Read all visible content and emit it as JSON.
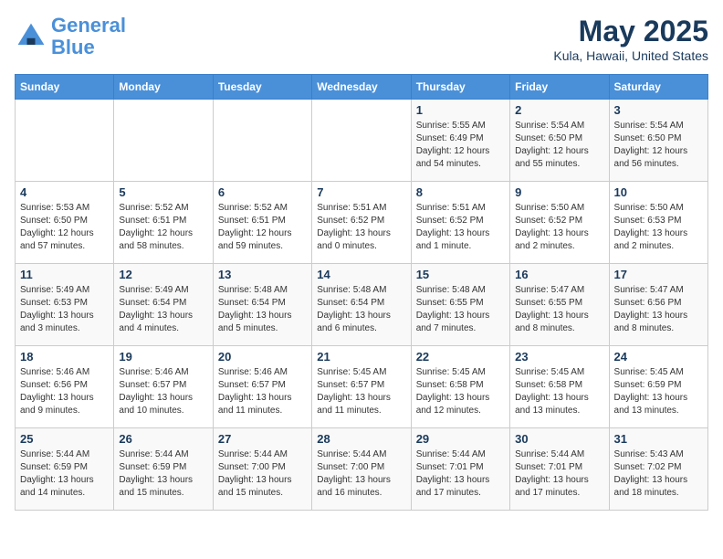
{
  "header": {
    "logo_line1": "General",
    "logo_line2": "Blue",
    "title": "May 2025",
    "subtitle": "Kula, Hawaii, United States"
  },
  "weekdays": [
    "Sunday",
    "Monday",
    "Tuesday",
    "Wednesday",
    "Thursday",
    "Friday",
    "Saturday"
  ],
  "weeks": [
    [
      {
        "day": "",
        "info": ""
      },
      {
        "day": "",
        "info": ""
      },
      {
        "day": "",
        "info": ""
      },
      {
        "day": "",
        "info": ""
      },
      {
        "day": "1",
        "info": "Sunrise: 5:55 AM\nSunset: 6:49 PM\nDaylight: 12 hours\nand 54 minutes."
      },
      {
        "day": "2",
        "info": "Sunrise: 5:54 AM\nSunset: 6:50 PM\nDaylight: 12 hours\nand 55 minutes."
      },
      {
        "day": "3",
        "info": "Sunrise: 5:54 AM\nSunset: 6:50 PM\nDaylight: 12 hours\nand 56 minutes."
      }
    ],
    [
      {
        "day": "4",
        "info": "Sunrise: 5:53 AM\nSunset: 6:50 PM\nDaylight: 12 hours\nand 57 minutes."
      },
      {
        "day": "5",
        "info": "Sunrise: 5:52 AM\nSunset: 6:51 PM\nDaylight: 12 hours\nand 58 minutes."
      },
      {
        "day": "6",
        "info": "Sunrise: 5:52 AM\nSunset: 6:51 PM\nDaylight: 12 hours\nand 59 minutes."
      },
      {
        "day": "7",
        "info": "Sunrise: 5:51 AM\nSunset: 6:52 PM\nDaylight: 13 hours\nand 0 minutes."
      },
      {
        "day": "8",
        "info": "Sunrise: 5:51 AM\nSunset: 6:52 PM\nDaylight: 13 hours\nand 1 minute."
      },
      {
        "day": "9",
        "info": "Sunrise: 5:50 AM\nSunset: 6:52 PM\nDaylight: 13 hours\nand 2 minutes."
      },
      {
        "day": "10",
        "info": "Sunrise: 5:50 AM\nSunset: 6:53 PM\nDaylight: 13 hours\nand 2 minutes."
      }
    ],
    [
      {
        "day": "11",
        "info": "Sunrise: 5:49 AM\nSunset: 6:53 PM\nDaylight: 13 hours\nand 3 minutes."
      },
      {
        "day": "12",
        "info": "Sunrise: 5:49 AM\nSunset: 6:54 PM\nDaylight: 13 hours\nand 4 minutes."
      },
      {
        "day": "13",
        "info": "Sunrise: 5:48 AM\nSunset: 6:54 PM\nDaylight: 13 hours\nand 5 minutes."
      },
      {
        "day": "14",
        "info": "Sunrise: 5:48 AM\nSunset: 6:54 PM\nDaylight: 13 hours\nand 6 minutes."
      },
      {
        "day": "15",
        "info": "Sunrise: 5:48 AM\nSunset: 6:55 PM\nDaylight: 13 hours\nand 7 minutes."
      },
      {
        "day": "16",
        "info": "Sunrise: 5:47 AM\nSunset: 6:55 PM\nDaylight: 13 hours\nand 8 minutes."
      },
      {
        "day": "17",
        "info": "Sunrise: 5:47 AM\nSunset: 6:56 PM\nDaylight: 13 hours\nand 8 minutes."
      }
    ],
    [
      {
        "day": "18",
        "info": "Sunrise: 5:46 AM\nSunset: 6:56 PM\nDaylight: 13 hours\nand 9 minutes."
      },
      {
        "day": "19",
        "info": "Sunrise: 5:46 AM\nSunset: 6:57 PM\nDaylight: 13 hours\nand 10 minutes."
      },
      {
        "day": "20",
        "info": "Sunrise: 5:46 AM\nSunset: 6:57 PM\nDaylight: 13 hours\nand 11 minutes."
      },
      {
        "day": "21",
        "info": "Sunrise: 5:45 AM\nSunset: 6:57 PM\nDaylight: 13 hours\nand 11 minutes."
      },
      {
        "day": "22",
        "info": "Sunrise: 5:45 AM\nSunset: 6:58 PM\nDaylight: 13 hours\nand 12 minutes."
      },
      {
        "day": "23",
        "info": "Sunrise: 5:45 AM\nSunset: 6:58 PM\nDaylight: 13 hours\nand 13 minutes."
      },
      {
        "day": "24",
        "info": "Sunrise: 5:45 AM\nSunset: 6:59 PM\nDaylight: 13 hours\nand 13 minutes."
      }
    ],
    [
      {
        "day": "25",
        "info": "Sunrise: 5:44 AM\nSunset: 6:59 PM\nDaylight: 13 hours\nand 14 minutes."
      },
      {
        "day": "26",
        "info": "Sunrise: 5:44 AM\nSunset: 6:59 PM\nDaylight: 13 hours\nand 15 minutes."
      },
      {
        "day": "27",
        "info": "Sunrise: 5:44 AM\nSunset: 7:00 PM\nDaylight: 13 hours\nand 15 minutes."
      },
      {
        "day": "28",
        "info": "Sunrise: 5:44 AM\nSunset: 7:00 PM\nDaylight: 13 hours\nand 16 minutes."
      },
      {
        "day": "29",
        "info": "Sunrise: 5:44 AM\nSunset: 7:01 PM\nDaylight: 13 hours\nand 17 minutes."
      },
      {
        "day": "30",
        "info": "Sunrise: 5:44 AM\nSunset: 7:01 PM\nDaylight: 13 hours\nand 17 minutes."
      },
      {
        "day": "31",
        "info": "Sunrise: 5:43 AM\nSunset: 7:02 PM\nDaylight: 13 hours\nand 18 minutes."
      }
    ]
  ]
}
